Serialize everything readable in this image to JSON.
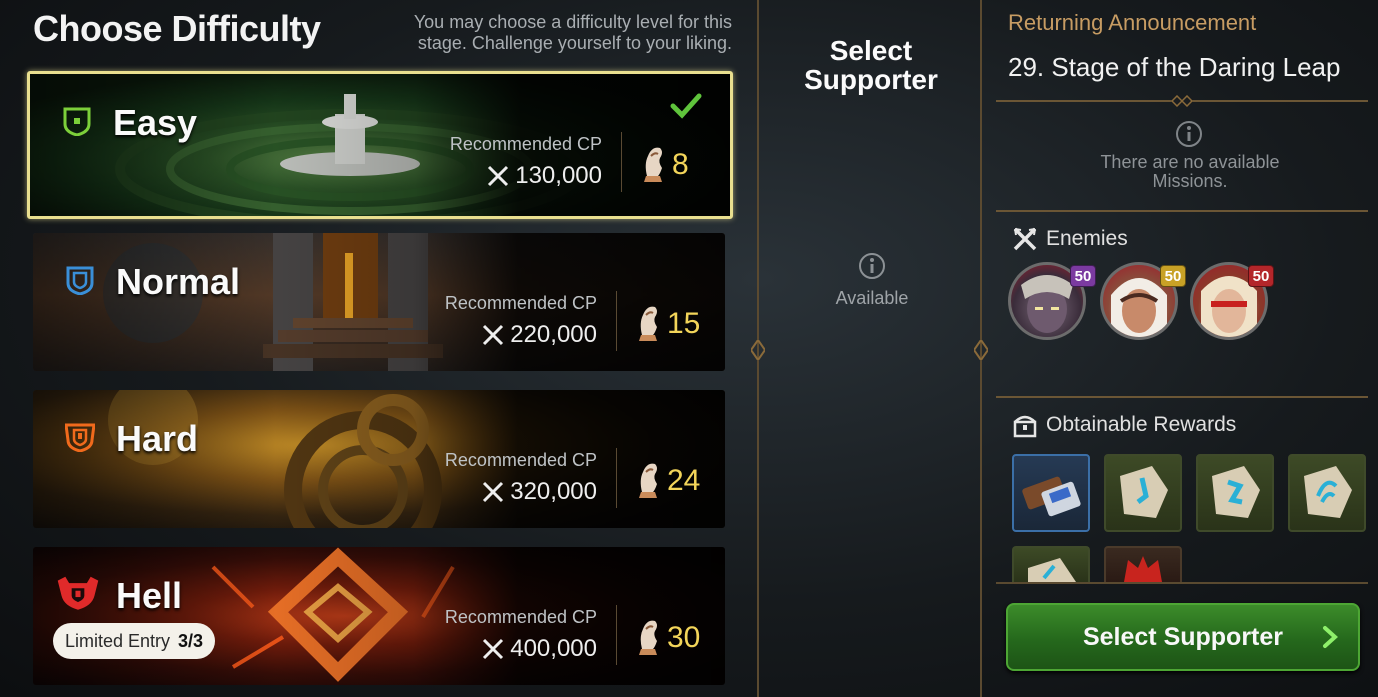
{
  "left": {
    "title": "Choose Difficulty",
    "subtitle": "You may choose a difficulty level for this stage. Challenge yourself to your liking.",
    "cards": [
      {
        "name": "Easy",
        "rc_label": "Recommended CP",
        "cp": "130,000",
        "stamina": "8",
        "selected": true,
        "icon": "easy-shield-icon"
      },
      {
        "name": "Normal",
        "rc_label": "Recommended CP",
        "cp": "220,000",
        "stamina": "15",
        "selected": false,
        "icon": "normal-shield-icon"
      },
      {
        "name": "Hard",
        "rc_label": "Recommended CP",
        "cp": "320,000",
        "stamina": "24",
        "selected": false,
        "icon": "hard-shield-icon"
      },
      {
        "name": "Hell",
        "rc_label": "Recommended CP",
        "cp": "400,000",
        "stamina": "30",
        "selected": false,
        "icon": "hell-shield-icon",
        "limited_label": "Limited Entry",
        "limited_count": "3/3"
      }
    ]
  },
  "middle": {
    "title_line1": "Select",
    "title_line2": "Supporter",
    "available": "Available"
  },
  "right": {
    "announcement": "Returning Announcement",
    "stage": "29. Stage of the Daring Leap",
    "no_missions": "There are no available Missions.",
    "enemies_label": "Enemies",
    "enemies": [
      {
        "level": "50",
        "badge_color": "#7b3aa0"
      },
      {
        "level": "50",
        "badge_color": "#c8a126"
      },
      {
        "level": "50",
        "badge_color": "#b3262a"
      }
    ],
    "rewards_label": "Obtainable Rewards",
    "button": "Select Supporter"
  },
  "colors": {
    "accent_gold": "#c79c63",
    "stamina_yellow": "#f3d55a",
    "button_green": "#2f7a23",
    "selected_border": "#e9df8f"
  }
}
